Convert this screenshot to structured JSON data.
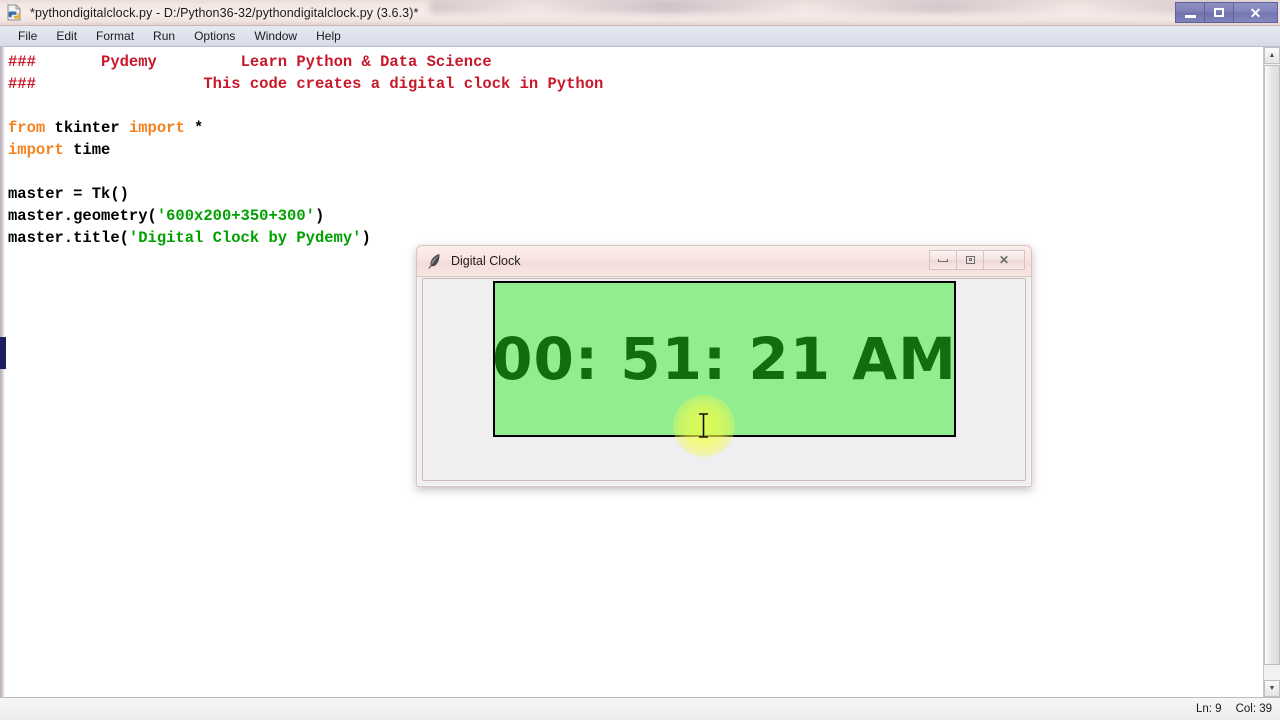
{
  "idle": {
    "titlebar": {
      "icon": "python-file-icon",
      "title": "*pythondigitalclock.py - D:/Python36-32/pythondigitalclock.py (3.6.3)*",
      "minimize_label": "Minimize",
      "maximize_label": "Maximize",
      "close_label": "Close"
    },
    "menu": [
      {
        "label": "File"
      },
      {
        "label": "Edit"
      },
      {
        "label": "Format"
      },
      {
        "label": "Run"
      },
      {
        "label": "Options"
      },
      {
        "label": "Window"
      },
      {
        "label": "Help"
      }
    ],
    "code_lines": [
      {
        "tokens": [
          {
            "t": "###",
            "c": "comment"
          },
          {
            "t": "       ",
            "c": "plain"
          },
          {
            "t": "Pydemy",
            "c": "comment"
          },
          {
            "t": "         ",
            "c": "plain"
          },
          {
            "t": "Learn Python & Data Science",
            "c": "comment"
          }
        ]
      },
      {
        "tokens": [
          {
            "t": "###",
            "c": "comment"
          },
          {
            "t": "                  ",
            "c": "plain"
          },
          {
            "t": "This code creates a digital clock in Python",
            "c": "comment"
          }
        ]
      },
      {
        "tokens": []
      },
      {
        "tokens": [
          {
            "t": "from",
            "c": "kw"
          },
          {
            "t": " tkinter ",
            "c": "plain"
          },
          {
            "t": "import",
            "c": "kw"
          },
          {
            "t": " *",
            "c": "plain"
          }
        ]
      },
      {
        "tokens": [
          {
            "t": "import",
            "c": "kw"
          },
          {
            "t": " time",
            "c": "plain"
          }
        ]
      },
      {
        "tokens": []
      },
      {
        "tokens": [
          {
            "t": "master = Tk()",
            "c": "plain"
          }
        ]
      },
      {
        "tokens": [
          {
            "t": "master.geometry(",
            "c": "plain"
          },
          {
            "t": "'600x200+350+300'",
            "c": "str"
          },
          {
            "t": ")",
            "c": "plain"
          }
        ]
      },
      {
        "tokens": [
          {
            "t": "master.title(",
            "c": "plain"
          },
          {
            "t": "'Digital Clock by Pydemy'",
            "c": "str"
          },
          {
            "t": ")",
            "c": "plain"
          }
        ]
      }
    ],
    "scrollbar": {
      "up_arrow": "▲",
      "down_arrow": "▼"
    },
    "statusbar": {
      "line": "Ln: 9",
      "column": "Col: 39"
    }
  },
  "clock_window": {
    "titlebar": {
      "icon": "tkinter-feather-icon",
      "title": "Digital Clock",
      "minimize_label": "Minimize",
      "maximize_label": "Maximize",
      "close_label": "Close"
    },
    "display": {
      "time_text": "00: 51: 21 AM",
      "background_color": "#90ee90",
      "text_color": "#136d10",
      "border_color": "#000000"
    }
  },
  "cursor": {
    "type": "i-beam-cursor",
    "highlight": "click-highlight-halo"
  },
  "colors": {
    "comment": "#c8182b",
    "keyword": "#f58220",
    "string": "#00a000",
    "plain": "#000000",
    "idle_titlebar": "#f5e7e4",
    "tk_titlebar": "#f8e4e1"
  }
}
